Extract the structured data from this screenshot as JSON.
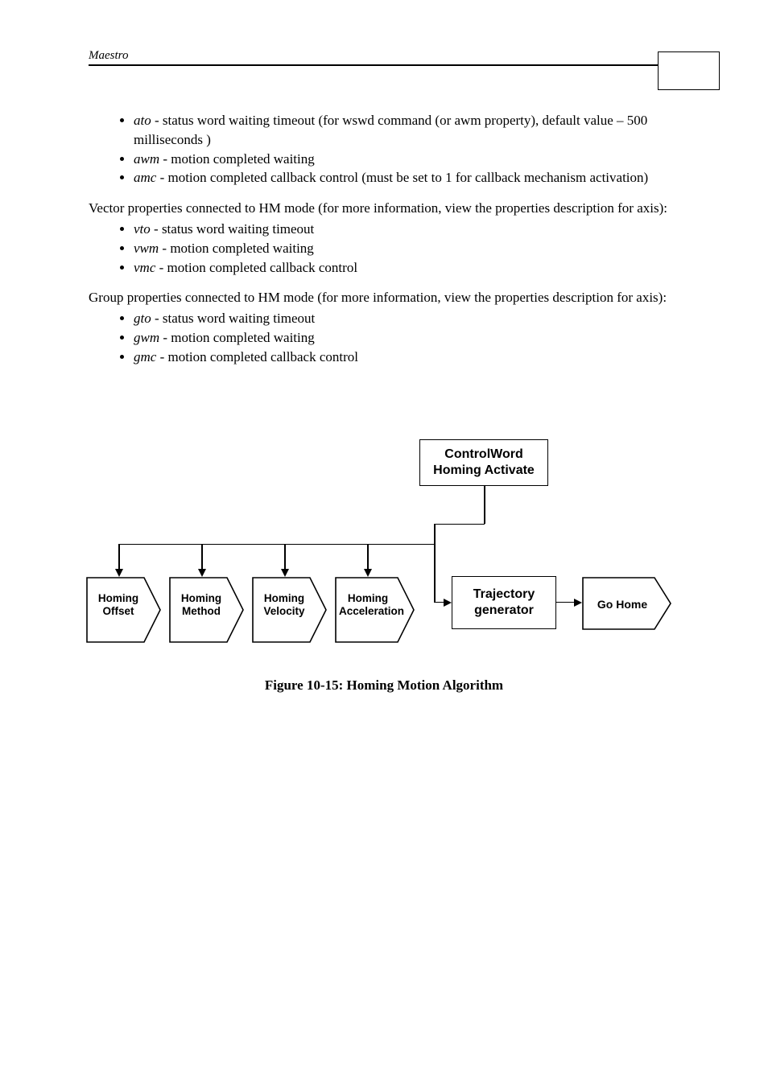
{
  "header": {
    "title": "Maestro"
  },
  "list1": [
    {
      "term": "ato",
      "desc": " - status word waiting timeout (for wswd command (or awm property), default value – 500 milliseconds )"
    },
    {
      "term": "awm",
      "desc": " - motion completed waiting"
    },
    {
      "term": "amc",
      "desc": " - motion completed callback control (must be set to 1 for callback mechanism activation)"
    }
  ],
  "para1": "Vector properties connected to HM mode (for more information, view the properties description for axis):",
  "list2": [
    {
      "term": "vto",
      "desc": " - status word waiting timeout"
    },
    {
      "term": "vwm",
      "desc": " - motion completed waiting"
    },
    {
      "term": "vmc",
      "desc": " - motion completed callback control"
    }
  ],
  "para2": "Group properties connected to HM mode (for more information, view the properties description for axis):",
  "list3": [
    {
      "term": "gto",
      "desc": " - status word waiting timeout"
    },
    {
      "term": "gwm",
      "desc": " - motion completed waiting"
    },
    {
      "term": "gmc",
      "desc": " - motion completed callback control"
    }
  ],
  "diagram": {
    "topbox_l1": "ControlWord",
    "topbox_l2": "Homing Activate",
    "traj_l1": "Trajectory",
    "traj_l2": "generator",
    "arrows": {
      "a0_l1": "Homing",
      "a0_l2": "Offset",
      "a1_l1": "Homing",
      "a1_l2": "Method",
      "a2_l1": "Homing",
      "a2_l2": "Velocity",
      "a3_l1": "Homing",
      "a3_l2": "Acceleration",
      "a4": "Go Home"
    }
  },
  "figcaption": "Figure 10-15: Homing Motion Algorithm"
}
